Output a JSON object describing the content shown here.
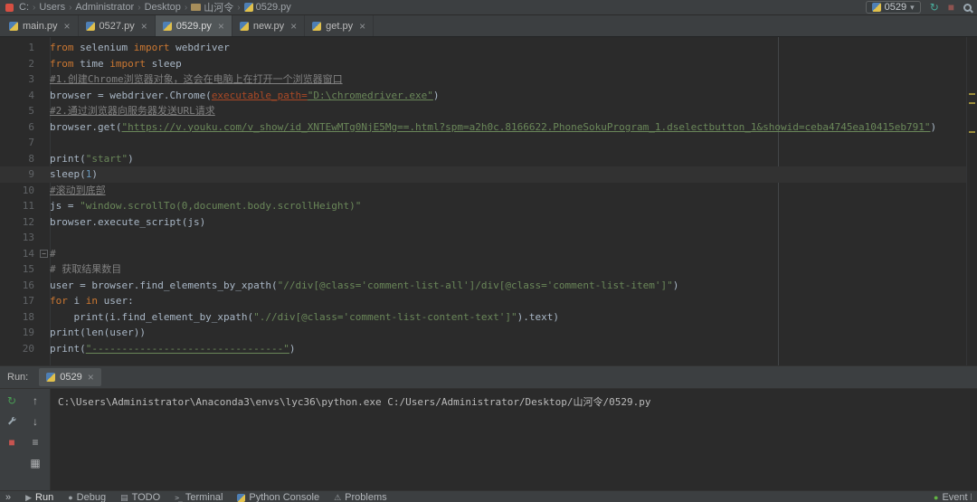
{
  "colors": {
    "keyword": "#cc7832",
    "string": "#6a8759",
    "comment": "#808080",
    "number": "#6897bb",
    "plain_code": "#a9b7c6",
    "named_param": "#aa4926",
    "editor_bg": "#2b2b2b",
    "panel_bg": "#3c3f41",
    "stop_red": "#c75450",
    "rerun_green": "#499c54"
  },
  "breadcrumb_bar": {
    "items": [
      {
        "label": "C:"
      },
      {
        "label": "Users"
      },
      {
        "label": "Administrator"
      },
      {
        "label": "Desktop"
      },
      {
        "label": "山河令",
        "icon": "folder"
      },
      {
        "label": "0529.py",
        "icon": "python"
      }
    ],
    "run_config": {
      "label": "0529"
    }
  },
  "editor_tabs": [
    {
      "label": "main.py",
      "active": false
    },
    {
      "label": "0527.py",
      "active": false
    },
    {
      "label": "0529.py",
      "active": true
    },
    {
      "label": "new.py",
      "active": false
    },
    {
      "label": "get.py",
      "active": false
    }
  ],
  "editor": {
    "lines": [
      {
        "n": 1,
        "tokens": [
          [
            "kw",
            "from"
          ],
          [
            "p",
            " selenium "
          ],
          [
            "kw",
            "import"
          ],
          [
            "p",
            " webdriver"
          ]
        ]
      },
      {
        "n": 2,
        "tokens": [
          [
            "kw",
            "from"
          ],
          [
            "p",
            " time "
          ],
          [
            "kw",
            "import"
          ],
          [
            "p",
            " sleep"
          ]
        ]
      },
      {
        "n": 3,
        "tokens": [
          [
            "cu",
            "#1.创建Chrome浏览器对象，这会在电脑上在打开一个浏览器窗口"
          ]
        ]
      },
      {
        "n": 4,
        "tokens": [
          [
            "p",
            "browser = webdriver.Chrome("
          ],
          [
            "pa",
            "executable_path="
          ],
          [
            "su",
            "\"D:\\chromedriver.exe\""
          ],
          [
            "p",
            ")"
          ]
        ]
      },
      {
        "n": 5,
        "tokens": [
          [
            "cu",
            "#2.通过浏览器向服务器发送URL请求"
          ]
        ]
      },
      {
        "n": 6,
        "tokens": [
          [
            "p",
            "browser.get("
          ],
          [
            "su",
            "\"https://v.youku.com/v_show/id_XNTEwMTg0NjE5Mg==.html?spm=a2h0c.8166622.PhoneSokuProgram_1.dselectbutton_1&showid=ceba4745ea10415eb791\""
          ],
          [
            "p",
            ")"
          ]
        ]
      },
      {
        "n": 7,
        "tokens": []
      },
      {
        "n": 8,
        "tokens": [
          [
            "p",
            "print("
          ],
          [
            "s",
            "\"start\""
          ],
          [
            "p",
            ")"
          ]
        ]
      },
      {
        "n": 9,
        "caret": true,
        "tokens": [
          [
            "p",
            "sleep("
          ],
          [
            "n",
            "1"
          ],
          [
            "p",
            ")"
          ]
        ]
      },
      {
        "n": 10,
        "tokens": [
          [
            "cu",
            "#滚动到底部"
          ]
        ]
      },
      {
        "n": 11,
        "tokens": [
          [
            "p",
            "js = "
          ],
          [
            "s",
            "\"window.scrollTo(0,document.body.scrollHeight)\""
          ]
        ]
      },
      {
        "n": 12,
        "tokens": [
          [
            "p",
            "browser.execute_script(js)"
          ]
        ]
      },
      {
        "n": 13,
        "tokens": []
      },
      {
        "n": 14,
        "fold": true,
        "tokens": [
          [
            "c",
            "#"
          ]
        ]
      },
      {
        "n": 15,
        "tokens": [
          [
            "c",
            "# 获取结果数目"
          ]
        ]
      },
      {
        "n": 16,
        "tokens": [
          [
            "p",
            "user = browser.find_elements_by_xpath("
          ],
          [
            "s",
            "\"//div[@class='comment-list-all']/div[@class='comment-list-item']\""
          ],
          [
            "p",
            ")"
          ]
        ]
      },
      {
        "n": 17,
        "tokens": [
          [
            "kw",
            "for"
          ],
          [
            "p",
            " i "
          ],
          [
            "kw",
            "in"
          ],
          [
            "p",
            " user:"
          ]
        ]
      },
      {
        "n": 18,
        "tokens": [
          [
            "p",
            "    print(i.find_element_by_xpath("
          ],
          [
            "s",
            "\".//div[@class='comment-list-content-text']\""
          ],
          [
            "p",
            ").text)"
          ]
        ]
      },
      {
        "n": 19,
        "tokens": [
          [
            "p",
            "print(len(user))"
          ]
        ]
      },
      {
        "n": 20,
        "tokens": [
          [
            "p",
            "print("
          ],
          [
            "su",
            "\"--------------------------------\""
          ],
          [
            "p",
            ")"
          ]
        ]
      }
    ]
  },
  "run_panel": {
    "title": "Run:",
    "tab": {
      "label": "0529"
    },
    "console_output": "C:\\Users\\Administrator\\Anaconda3\\envs\\lyc36\\python.exe C:/Users/Administrator/Desktop/山河令/0529.py"
  },
  "run_toolbar": [
    {
      "name": "rerun-icon",
      "glyph": "↻",
      "color": "#499c54"
    },
    {
      "name": "up-arrow-icon",
      "glyph": "↑",
      "color": "#afb1b3"
    },
    {
      "name": "settings-icon",
      "glyph": "wrench",
      "color": "#9aa7b0"
    },
    {
      "name": "down-arrow-icon",
      "glyph": "↓",
      "color": "#afb1b3"
    },
    {
      "name": "stop-icon",
      "glyph": "■",
      "color": "#c75450"
    },
    {
      "name": "scroll-to-end-icon",
      "glyph": "≡",
      "color": "#afb1b3"
    },
    {
      "name": "soft-wrap-icon",
      "glyph": "▦",
      "color": "#afb1b3"
    }
  ],
  "status_bar": {
    "expander": "»",
    "left_items": [
      {
        "label": "Run",
        "icon": "run",
        "active": true
      },
      {
        "label": "Debug",
        "icon": "debug",
        "active": false
      },
      {
        "label": "TODO",
        "icon": "todo",
        "active": false
      },
      {
        "label": "Terminal",
        "icon": "terminal",
        "active": false
      },
      {
        "label": "Python Console",
        "icon": "python",
        "active": false
      },
      {
        "label": "Problems",
        "icon": "problems",
        "active": false
      }
    ],
    "right_item": {
      "label": "Event Log",
      "icon": "event"
    }
  }
}
